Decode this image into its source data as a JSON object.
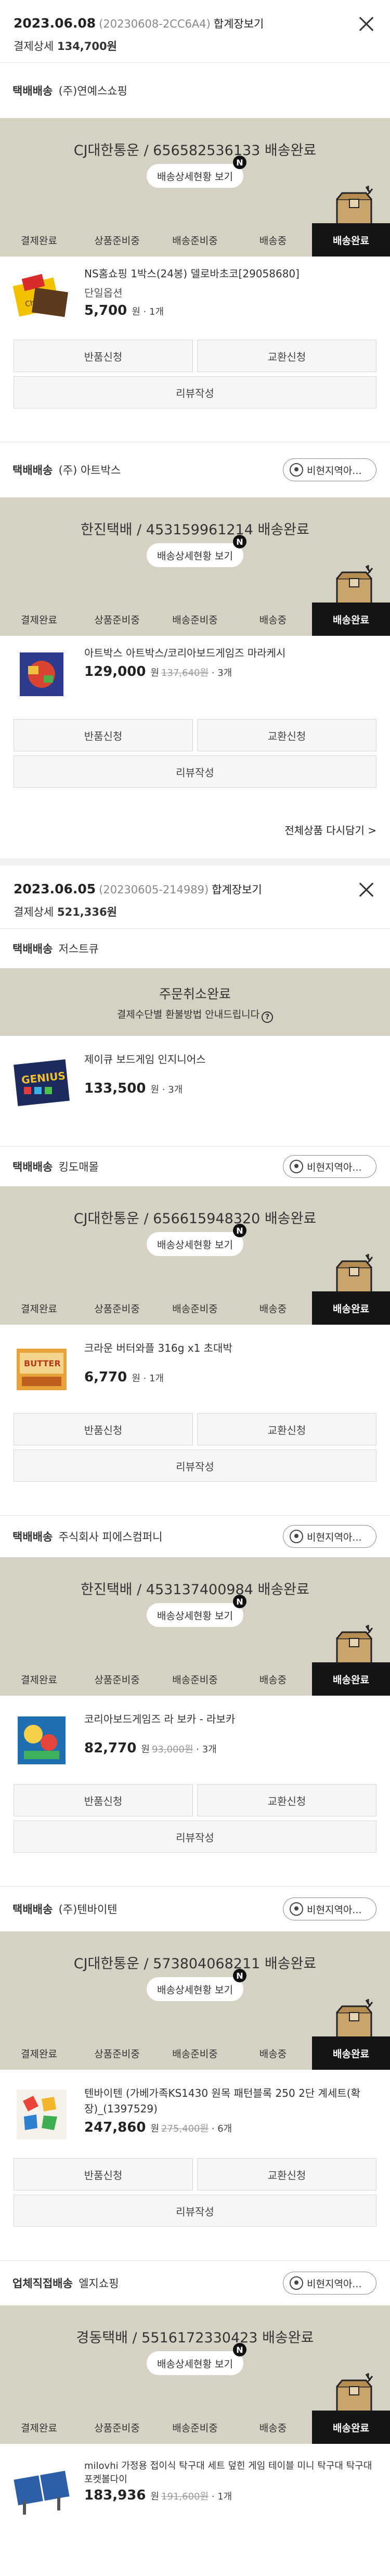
{
  "labels": {
    "total_prefix": "결제상세",
    "won": "원",
    "track_btn": "배송상세현황 보기",
    "n_badge": "N",
    "ship_btn": "비현지역아...",
    "return_btn": "반품신청",
    "exchange_btn": "교환신청",
    "review_btn": "리뷰작성",
    "steps": [
      "결제완료",
      "상품준비중",
      "배송준비중",
      "배송중",
      "배송완료"
    ]
  },
  "orders": [
    {
      "date": "2023.06.08",
      "number": "(20230608-2CC6A4)",
      "view_link": "합계장보기",
      "total": "134,700원",
      "groups": [
        {
          "ship_type": "택배배송",
          "seller": "(주)연예스쇼핑",
          "banner_title": "CJ대한통운 / 656582536133 배송완료",
          "product": {
            "name": "NS홈쇼핑 1박스(24봉) 델로바초코[29058680]",
            "option": "단일옵션",
            "price": "5,700",
            "orig_price": "",
            "qty": "1개"
          }
        },
        {
          "ship_type": "택배배송",
          "seller": "(주) 아트박스",
          "banner_title": "한진택배 / 453159961214 배송완료",
          "product": {
            "name": "아트박스 아트박스/코리아보드게임즈 마라케시",
            "option": "",
            "price": "129,000",
            "orig_price": "137,640원",
            "qty": "3개"
          }
        }
      ],
      "all_link": "전체상품 다시담기 >"
    },
    {
      "date": "2023.06.05",
      "number": "(20230605-214989)",
      "view_link": "합계장보기",
      "total": "521,336원",
      "cancel_group": {
        "ship_type": "택배배송",
        "seller": "저스트큐",
        "title": "주문취소완료",
        "sub": "결제수단별 환불방법 안내드립니다",
        "product": {
          "name": "제이큐 보드게임 인지니어스",
          "price": "133,500",
          "qty": "3개"
        }
      },
      "groups": [
        {
          "ship_type": "택배배송",
          "seller": "킹도매몰",
          "banner_title": "CJ대한통운 / 656615948320 배송완료",
          "product": {
            "name": "크라운 버터와플 316g x1 초대박",
            "option": "",
            "price": "6,770",
            "orig_price": "",
            "qty": "1개"
          }
        },
        {
          "ship_type": "택배배송",
          "seller": "주식회사 피에스컴퍼니",
          "banner_title": "한진택배 / 453137400984 배송완료",
          "product": {
            "name": "코리아보드게임즈 라 보카 - 라보카",
            "option": "",
            "price": "82,770",
            "orig_price": "93,000원",
            "qty": "3개"
          }
        },
        {
          "ship_type": "택배배송",
          "seller": "(주)텐바이텐",
          "banner_title": "CJ대한통운 / 573804068211 배송완료",
          "product": {
            "name": "텐바이텐 (가베가족KS1430 원목 패턴블록 250 2단 계세트(확장)_(1397529)",
            "option": "",
            "price": "247,860",
            "orig_price": "275,400원",
            "qty": "6개"
          }
        },
        {
          "ship_type": "업체직접배송",
          "seller": "엘지쇼핑",
          "banner_title": "경동택배 / 5516172330423 배송완료",
          "product": {
            "name": "milovhi 가정용 접이식 탁구대 세트 덮힌 게임 테이블 미니 탁구대 탁구대 포켓볼다이",
            "option": "",
            "price": "183,936",
            "orig_price": "191,600원",
            "qty": "1개"
          }
        }
      ]
    }
  ]
}
